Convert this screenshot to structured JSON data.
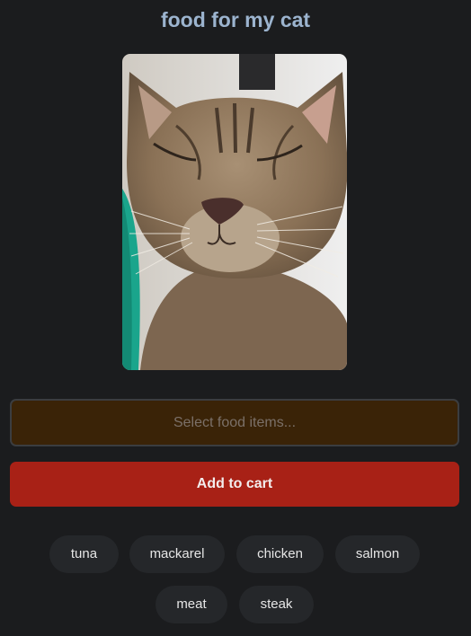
{
  "header": {
    "title": "food for my cat"
  },
  "photo": {
    "alt": "cat photo"
  },
  "food_select": {
    "placeholder": "Select food items...",
    "value": ""
  },
  "actions": {
    "add_to_cart_label": "Add to cart"
  },
  "food_chips": [
    {
      "label": "tuna"
    },
    {
      "label": "mackarel"
    },
    {
      "label": "chicken"
    },
    {
      "label": "salmon"
    },
    {
      "label": "meat"
    },
    {
      "label": "steak"
    }
  ],
  "colors": {
    "background": "#1b1c1e",
    "title": "#9cb4cf",
    "input_bg": "#3a2307",
    "button_bg": "#a82116",
    "chip_bg": "#25272a"
  }
}
